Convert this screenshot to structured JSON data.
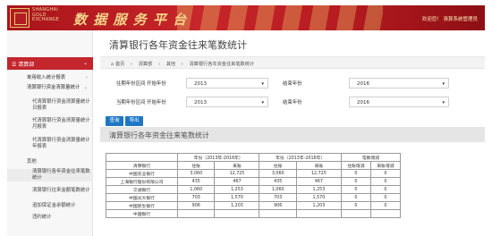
{
  "header": {
    "logo_lines": [
      "SHANGHAI",
      "GOLD",
      "EXCHANGE"
    ],
    "title": "数 据 服 务 平 台",
    "welcome": "欢迎您！ 清算系统管理员"
  },
  "sidebar": {
    "head": "清算部",
    "items": [
      {
        "label": "单用收入统计报表"
      },
      {
        "label": "清算银行资金清算量统计"
      }
    ],
    "subitems": [
      {
        "label": "代清算银行资金清算量统计日报表"
      },
      {
        "label": "代清算银行资金清算量统计月报表"
      },
      {
        "label": "代清算银行资金清算量统计年报表"
      },
      {
        "label": "其他"
      },
      {
        "label": "清算银行各年资金往来笔数统计"
      },
      {
        "label": "清算银行往来金额笔数统计"
      },
      {
        "label": "追加保证金余额统计"
      },
      {
        "label": "违约统计"
      }
    ]
  },
  "main": {
    "title": "清算银行各年资金往来笔数统计",
    "breadcrumb": [
      "⌂ 首页",
      "›",
      "清算部",
      "›",
      "其他",
      "›",
      "清算银行各年资金往来笔数统计"
    ],
    "filters": {
      "prev_range_label": "往期年份区间  开始年份",
      "prev_start": "2013",
      "prev_end_label": "结束年份",
      "prev_end": "2016",
      "cur_range_label": "当期年份区间  开始年份",
      "cur_start": "2013",
      "cur_end_label": "结束年份",
      "cur_end": "2016"
    },
    "buttons": {
      "query": "查询",
      "export": "导出"
    },
    "section_title": "清算银行各年资金往来笔数统计"
  },
  "table": {
    "group_headers": [
      "年份（2013年-2016年）",
      "年份（2013年-2016年）",
      "笔数增减"
    ],
    "col_headers": [
      "清算银行",
      "往账",
      "来账",
      "往账",
      "来账",
      "往账增减",
      "来账增减"
    ],
    "rows": [
      [
        "中国农业银行",
        "3,060",
        "12,725",
        "3,060",
        "12,725",
        "0",
        "0"
      ],
      [
        "上海银行股份有限公司",
        "435",
        "467",
        "435",
        "467",
        "0",
        "0"
      ],
      [
        "交通银行",
        "1,060",
        "1,253",
        "1,060",
        "1,253",
        "0",
        "0"
      ],
      [
        "中国光大银行",
        "703",
        "1,570",
        "703",
        "1,570",
        "0",
        "0"
      ],
      [
        "中国民生银行",
        "906",
        "1,203",
        "906",
        "1,203",
        "0",
        "0"
      ],
      [
        "中国银行",
        "",
        "",
        "",
        "",
        "",
        ""
      ]
    ]
  },
  "colors": {
    "brand_red": "#c3262c",
    "button_blue": "#1e77c4"
  }
}
